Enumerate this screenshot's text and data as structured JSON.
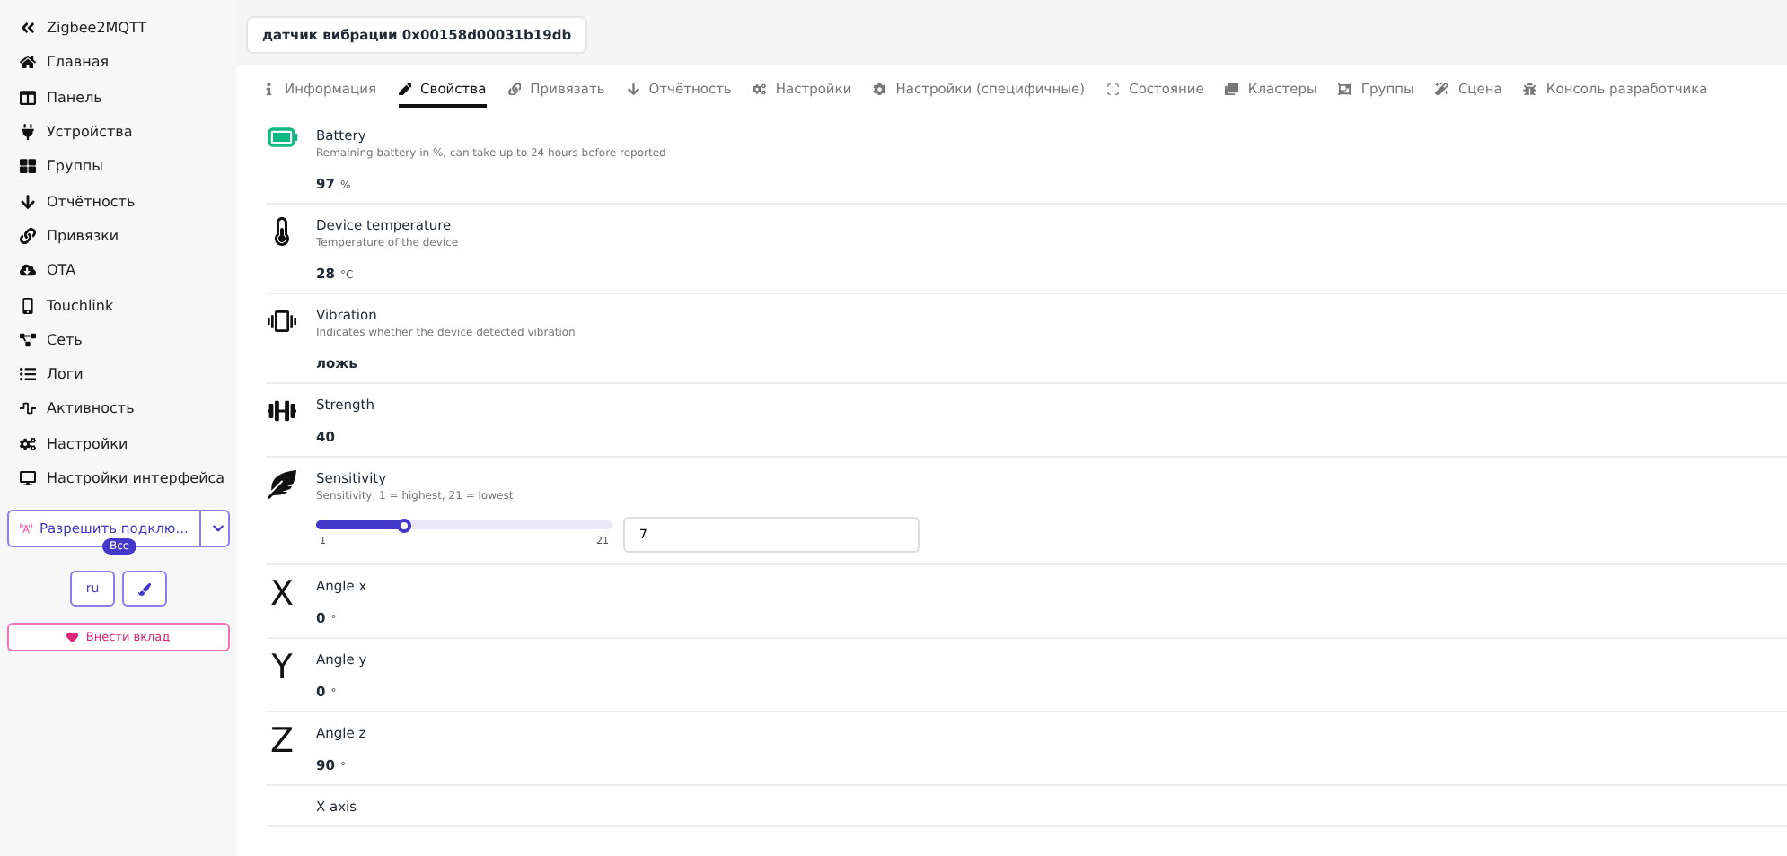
{
  "sidebar": {
    "brand": "Zigbee2MQTT",
    "items": [
      {
        "label": "Главная"
      },
      {
        "label": "Панель"
      },
      {
        "label": "Устройства"
      },
      {
        "label": "Группы"
      },
      {
        "label": "Отчётность"
      },
      {
        "label": "Привязки"
      },
      {
        "label": "OTA"
      },
      {
        "label": "Touchlink"
      },
      {
        "label": "Сеть"
      },
      {
        "label": "Логи"
      },
      {
        "label": "Активность"
      },
      {
        "label": "Настройки"
      },
      {
        "label": "Настройки интерфейса"
      }
    ],
    "permit_join": {
      "label": "Разрешить подклю...",
      "badge": "Все"
    },
    "language": "ru",
    "donate": "Внести вклад"
  },
  "device_title": "датчик вибрации 0x00158d00031b19db",
  "tabs": [
    {
      "label": "Информация",
      "selected": false
    },
    {
      "label": "Свойства",
      "selected": true
    },
    {
      "label": "Привязать",
      "selected": false
    },
    {
      "label": "Отчётность",
      "selected": false
    },
    {
      "label": "Настройки",
      "selected": false
    },
    {
      "label": "Настройки (специфичные)",
      "selected": false
    },
    {
      "label": "Состояние",
      "selected": false
    },
    {
      "label": "Кластеры",
      "selected": false
    },
    {
      "label": "Группы",
      "selected": false
    },
    {
      "label": "Сцена",
      "selected": false
    },
    {
      "label": "Консоль разработчика",
      "selected": false
    }
  ],
  "properties": [
    {
      "kind": "reading",
      "title": "Battery",
      "description": "Remaining battery in %, can take up to 24 hours before reported",
      "value": "97",
      "unit": "%"
    },
    {
      "kind": "reading",
      "title": "Device temperature",
      "description": "Temperature of the device",
      "value": "28",
      "unit": "°C"
    },
    {
      "kind": "reading",
      "title": "Vibration",
      "description": "Indicates whether the device detected vibration",
      "value": "ложь"
    },
    {
      "kind": "reading",
      "title": "Strength",
      "value": "40"
    },
    {
      "kind": "slider",
      "title": "Sensitivity",
      "description": "Sensitivity, 1 = highest, 21 = lowest",
      "level": 0.3,
      "min": "1",
      "max": "21",
      "value": "7"
    },
    {
      "kind": "reading",
      "glyph": "X",
      "title": "Angle x",
      "value": "0",
      "unit": "°"
    },
    {
      "kind": "reading",
      "glyph": "Y",
      "title": "Angle y",
      "value": "0",
      "unit": "°"
    },
    {
      "kind": "reading",
      "glyph": "Z",
      "title": "Angle z",
      "value": "90",
      "unit": "°"
    },
    {
      "kind": "title_only",
      "title": "X axis"
    }
  ]
}
